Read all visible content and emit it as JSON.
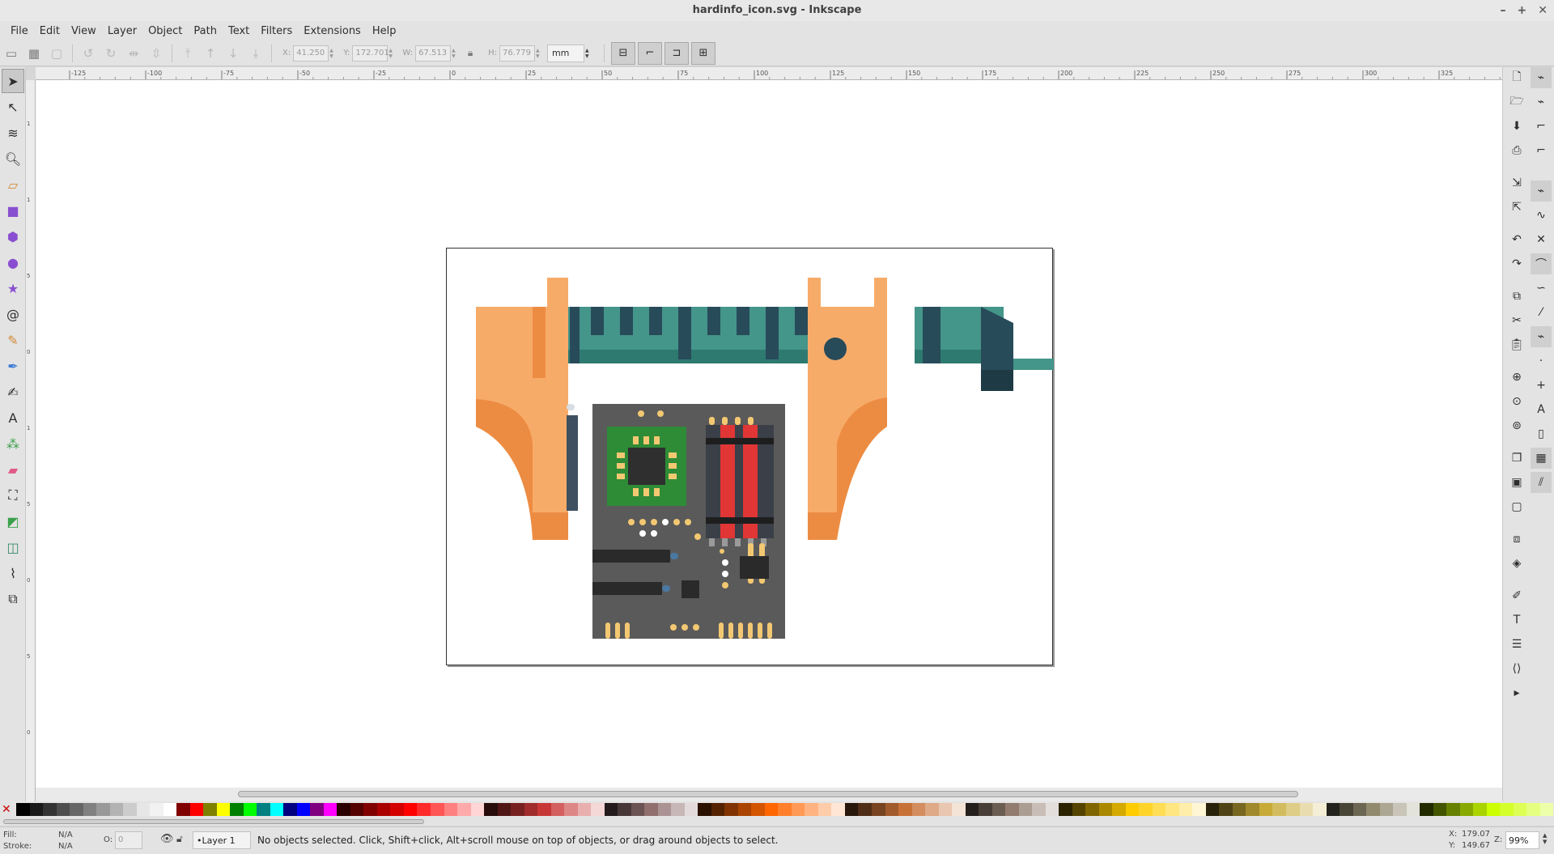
{
  "window": {
    "title": "hardinfo_icon.svg - Inkscape",
    "controls": [
      "–",
      "+",
      "✕"
    ]
  },
  "menu": [
    "File",
    "Edit",
    "View",
    "Layer",
    "Object",
    "Path",
    "Text",
    "Filters",
    "Extensions",
    "Help"
  ],
  "toolctrl": {
    "x_label": "X:",
    "x_value": "41.250",
    "y_label": "Y:",
    "y_value": "172.701",
    "w_label": "W:",
    "w_value": "67.513",
    "h_label": "H:",
    "h_value": "76.779",
    "unit": "mm"
  },
  "hruler_ticks": [
    "-125",
    "-100",
    "-75",
    "-50",
    "-25",
    "0",
    "25",
    "50",
    "75",
    "100",
    "125",
    "150",
    "175",
    "200",
    "225",
    "250",
    "275",
    "300",
    "325"
  ],
  "vruler_ticks": [
    "1",
    "1",
    "5",
    "0",
    "1",
    "5",
    "0",
    "5",
    "0"
  ],
  "tools": [
    "selector-tool",
    "node-tool",
    "tweak-tool",
    "zoom-tool",
    "measure-tool",
    "rectangle-tool",
    "box-3d-tool",
    "ellipse-tool",
    "star-tool",
    "spiral-tool",
    "pencil-tool",
    "pen-tool",
    "calligraphy-tool",
    "text-tool",
    "spray-tool",
    "eraser-tool",
    "paint-bucket-tool",
    "gradient-tool",
    "mesh-tool",
    "dropper-tool",
    "connector-tool"
  ],
  "palette": [
    "#000000",
    "#1a1a1a",
    "#333333",
    "#4d4d4d",
    "#666666",
    "#808080",
    "#999999",
    "#b3b3b3",
    "#cccccc",
    "#e6e6e6",
    "#f2f2f2",
    "#ffffff",
    "#800000",
    "#ff0000",
    "#808000",
    "#ffff00",
    "#008000",
    "#00ff00",
    "#008080",
    "#00ffff",
    "#000080",
    "#0000ff",
    "#800080",
    "#ff00ff",
    "#2b0000",
    "#550000",
    "#800000",
    "#aa0000",
    "#d40000",
    "#ff0000",
    "#ff2a2a",
    "#ff5555",
    "#ff8080",
    "#ffaaaa",
    "#ffd5d5",
    "#280b0b",
    "#501616",
    "#782121",
    "#a02c2c",
    "#c83737",
    "#d35f5f",
    "#de8787",
    "#e9afaf",
    "#f4d7d7",
    "#241c1c",
    "#483737",
    "#6c5353",
    "#916f6f",
    "#ac9393",
    "#c8b7b7",
    "#e3dbdb",
    "#2b1100",
    "#552200",
    "#803300",
    "#aa4400",
    "#d45500",
    "#ff6600",
    "#ff7f2a",
    "#ff9955",
    "#ffb380",
    "#ffccaa",
    "#ffe6d5",
    "#28170b",
    "#502d16",
    "#784421",
    "#a05a2c",
    "#c87137",
    "#d38d5f",
    "#deaa87",
    "#e9c6af",
    "#f4e3d7",
    "#241f1c",
    "#483e37",
    "#6c5d53",
    "#917c6f",
    "#ac9d93",
    "#c8beb7",
    "#e3dedb",
    "#2b2200",
    "#554400",
    "#806600",
    "#aa8800",
    "#d4aa00",
    "#ffcc00",
    "#ffd42a",
    "#ffdd55",
    "#ffe680",
    "#ffeeaa",
    "#fff6d5",
    "#28220b",
    "#504416",
    "#786721",
    "#a0892c",
    "#c8ab37",
    "#d3bc5f",
    "#decd87",
    "#e9ddaf",
    "#f4eed7",
    "#24221c",
    "#484537",
    "#6c6753",
    "#918a6f",
    "#aca793",
    "#c8c4b7",
    "#e3e2db",
    "#222b00",
    "#445500",
    "#668000",
    "#88aa00",
    "#aad400",
    "#ccff00",
    "#d4ff2a",
    "#ddff55",
    "#e5ff80",
    "#eeffaa"
  ],
  "status": {
    "fill_label": "Fill:",
    "fill_value": "N/A",
    "stroke_label": "Stroke:",
    "stroke_value": "N/A",
    "opacity_label": "O:",
    "opacity_value": "0",
    "layer": "•Layer 1",
    "message": "No objects selected. Click, Shift+click, Alt+scroll mouse on top of objects, or drag around objects to select.",
    "x_label": "X:",
    "x_value": "179.07",
    "y_label": "Y:",
    "y_value": "149.67",
    "zoom_label": "Z:",
    "zoom_value": "99%"
  },
  "colors": {
    "caliper_orange": "#f7ab69",
    "caliper_dark_orange": "#ec8c42",
    "teal": "#44958a",
    "teal_dark": "#2e7a70",
    "slate": "#284b5a",
    "pcb_gray": "#5a5a5a",
    "chip_green": "#2e8b36",
    "gold": "#f3c872",
    "red": "#e03636"
  }
}
